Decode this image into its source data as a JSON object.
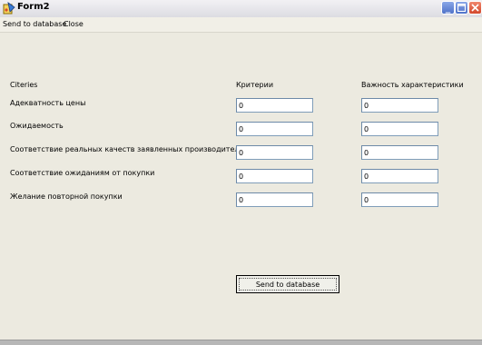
{
  "window": {
    "title": "Form2"
  },
  "menu": {
    "send": "Send to database",
    "close": "Close"
  },
  "headers": {
    "criteria_en": "Citeries",
    "criteria_ru": "Критерии",
    "importance": "Важность характеристики"
  },
  "rows": [
    {
      "label": "Адекватность цены",
      "criterion": "0",
      "importance": "0"
    },
    {
      "label": "Ожидаемость",
      "criterion": "0",
      "importance": "0"
    },
    {
      "label": "Соответствие реальных качеств заявленных производителем",
      "criterion": "0",
      "importance": "0"
    },
    {
      "label": "Соответствие ожиданиям от покупки",
      "criterion": "0",
      "importance": "0"
    },
    {
      "label": "Желание повторной покупки",
      "criterion": "0",
      "importance": "0"
    }
  ],
  "button": {
    "send": "Send to database"
  },
  "icons": {
    "app": "app-icon",
    "minimize": "minimize-icon",
    "maximize": "maximize-icon",
    "close": "close-icon"
  },
  "colors": {
    "window_bg": "#eceae0",
    "close_btn": "#d2482b",
    "caption_btn": "#4f72c8"
  }
}
